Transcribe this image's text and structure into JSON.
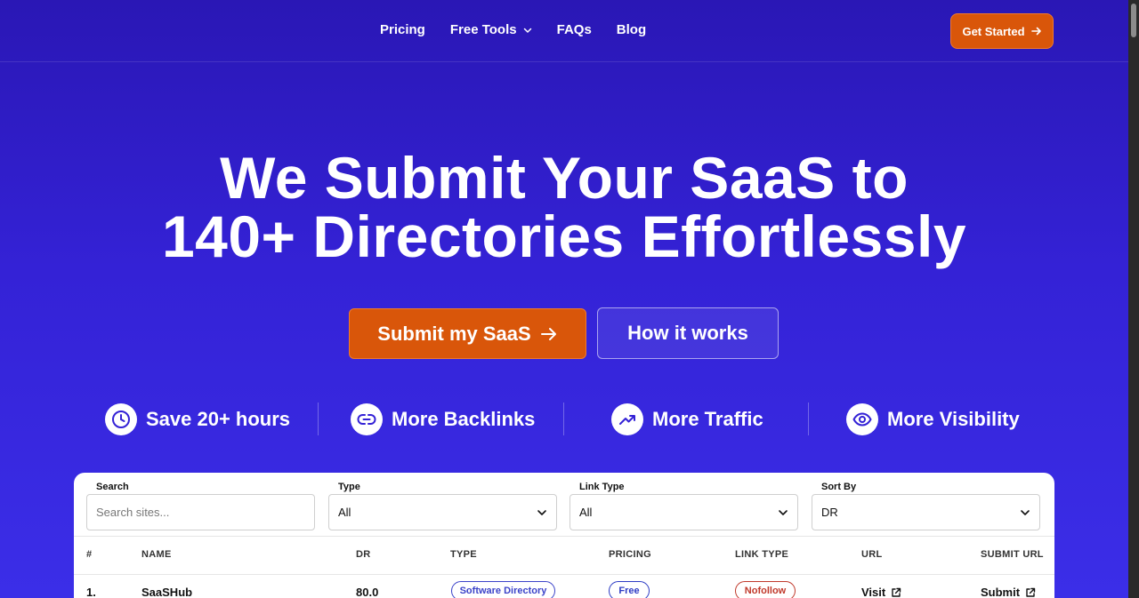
{
  "nav": {
    "links": [
      "Pricing",
      "Free Tools",
      "FAQs",
      "Blog"
    ],
    "cta_label": "Get Started"
  },
  "hero": {
    "line1": "We Submit Your SaaS to",
    "line2": "140+ Directories Effortlessly",
    "primary_cta": "Submit my SaaS",
    "secondary_cta": "How it works"
  },
  "benefits": [
    {
      "icon": "clock-icon",
      "label": "Save 20+ hours"
    },
    {
      "icon": "link-icon",
      "label": "More Backlinks"
    },
    {
      "icon": "trending-up-icon",
      "label": "More Traffic"
    },
    {
      "icon": "eye-icon",
      "label": "More Visibility"
    }
  ],
  "filters": {
    "search_label": "Search",
    "search_placeholder": "Search sites...",
    "type_label": "Type",
    "type_value": "All",
    "link_type_label": "Link Type",
    "link_type_value": "All",
    "sort_label": "Sort By",
    "sort_value": "DR"
  },
  "table": {
    "headers": [
      "#",
      "NAME",
      "DR",
      "TYPE",
      "PRICING",
      "LINK TYPE",
      "URL",
      "SUBMIT URL"
    ],
    "rows": [
      {
        "rank": "1.",
        "name": "SaaSHub",
        "dr": "80.0",
        "type": "Software Directory",
        "pricing": "Free",
        "link_type": "Nofollow",
        "url": "Visit",
        "submit_url": "Submit"
      }
    ]
  },
  "colors": {
    "accent_orange": "#d9560a",
    "bg_blue": "#3422d6",
    "pill_blue": "#3b43c9",
    "pill_red": "#c0392b"
  }
}
